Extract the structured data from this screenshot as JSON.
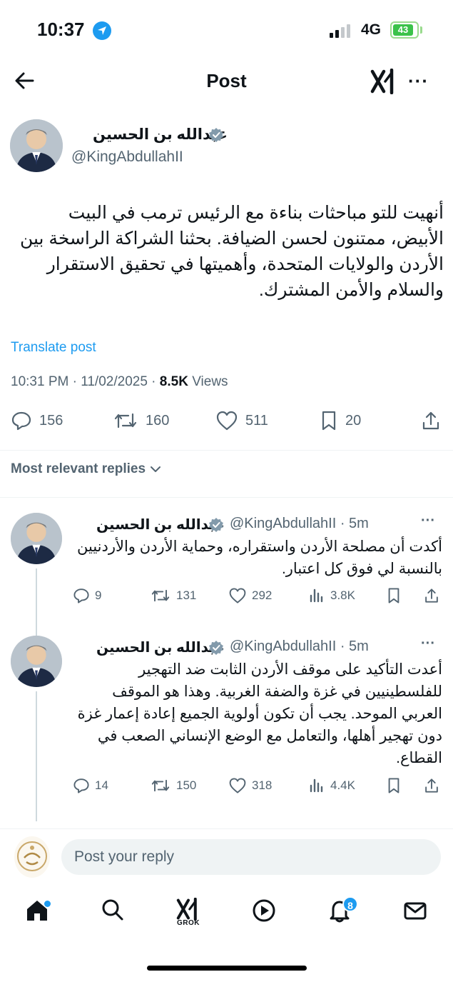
{
  "status_bar": {
    "time": "10:37",
    "network": "4G",
    "battery": "43"
  },
  "header": {
    "title": "Post",
    "more_label": "···"
  },
  "post": {
    "author_name": "عبدالله بن الحسين",
    "author_handle": "@KingAbdullahII",
    "text": "أنهيت للتو مباحثات بناءة مع الرئيس ترمب في البيت الأبيض، ممتنون لحسن الضيافة. بحثنا الشراكة الراسخة بين الأردن والولايات المتحدة، وأهميتها في تحقيق الاستقرار والسلام والأمن المشترك.",
    "translate_label": "Translate post",
    "meta_time": "10:31 PM · 11/02/2025 · ",
    "views_count": "8.5K",
    "views_label": " Views",
    "stats": {
      "replies": "156",
      "reposts": "160",
      "likes": "511",
      "bookmarks": "20"
    }
  },
  "replies_sort_label": "Most relevant replies",
  "replies": [
    {
      "author_name": "عبدالله بن الحسين",
      "handle_time": "@KingAbdullahII · 5m",
      "more_label": "···",
      "text": "أكدت أن مصلحة الأردن واستقراره، وحماية الأردن والأردنيين بالنسبة لي فوق كل اعتبار.",
      "replies": "9",
      "reposts": "131",
      "likes": "292",
      "views": "3.8K"
    },
    {
      "author_name": "عبدالله بن الحسين",
      "handle_time": "@KingAbdullahII · 5m",
      "more_label": "···",
      "text": "أعدت التأكيد على موقف الأردن الثابت ضد التهجير للفلسطينيين في غزة والضفة الغربية. وهذا هو الموقف العربي الموحد. يجب أن تكون أولوية الجميع إعادة إعمار غزة دون تهجير أهلها، والتعامل مع الوضع الإنساني الصعب في القطاع.",
      "replies": "14",
      "reposts": "150",
      "likes": "318",
      "views": "4.4K"
    }
  ],
  "composer": {
    "placeholder": "Post your reply"
  },
  "bottom_nav": {
    "grok_label": "GROK",
    "notifications_badge": "8"
  },
  "colors": {
    "accent": "#1d9bf0",
    "secondary_text": "#536471",
    "primary_text": "#0f1419"
  }
}
